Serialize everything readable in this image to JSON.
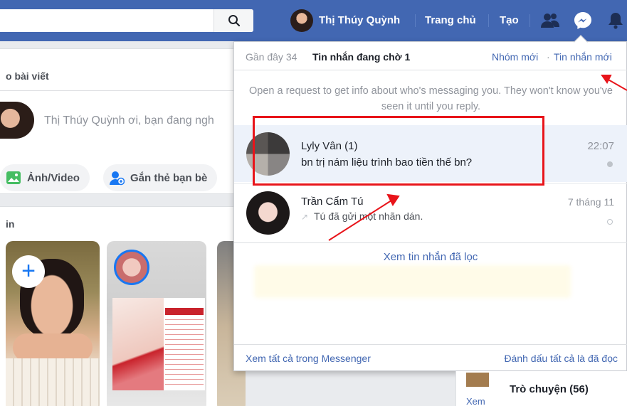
{
  "topbar": {
    "user_name": "Thị Thúy Quỳnh",
    "home_label": "Trang chủ",
    "create_label": "Tạo",
    "search_placeholder": ""
  },
  "feed": {
    "composer_title": "o bài viết",
    "composer_placeholder": "Thị Thúy Quỳnh ơi, bạn đang ngh",
    "photo_video_label": "Ảnh/Video",
    "tag_friends_label": "Gắn thẻ bạn bè",
    "stories_title": "in",
    "story_add_symbol": "+"
  },
  "messages_panel": {
    "tab_recent": "Gần đây 34",
    "tab_pending": "Tin nhắn đang chờ 1",
    "new_group": "Nhóm mới",
    "separator": "·",
    "new_message": "Tin nhắn mới",
    "info_text": "Open a request to get info about who's messaging you. They won't know you've seen it until you reply.",
    "threads": [
      {
        "name": "Lyly Vân (1)",
        "message": "bn trị nám liệu trình bao tiền thế bn?",
        "time": "22:07",
        "unread": true
      },
      {
        "name": "Trần Cẩm Tú",
        "message": "Tú đã gửi một nhãn dán.",
        "time": "7 tháng 11",
        "unread": false
      }
    ],
    "filtered_link": "Xem tin nhắn đã lọc",
    "footer_left": "Xem tất cả trong Messenger",
    "footer_right": "Đánh dấu tất cả là đã đọc"
  },
  "chat": {
    "label": "Trò chuyện (56)",
    "see_more": "Xem"
  },
  "colors": {
    "brand_blue": "#4267b2",
    "annotation_red": "#e8141a",
    "selected_row": "#edf2fa"
  }
}
